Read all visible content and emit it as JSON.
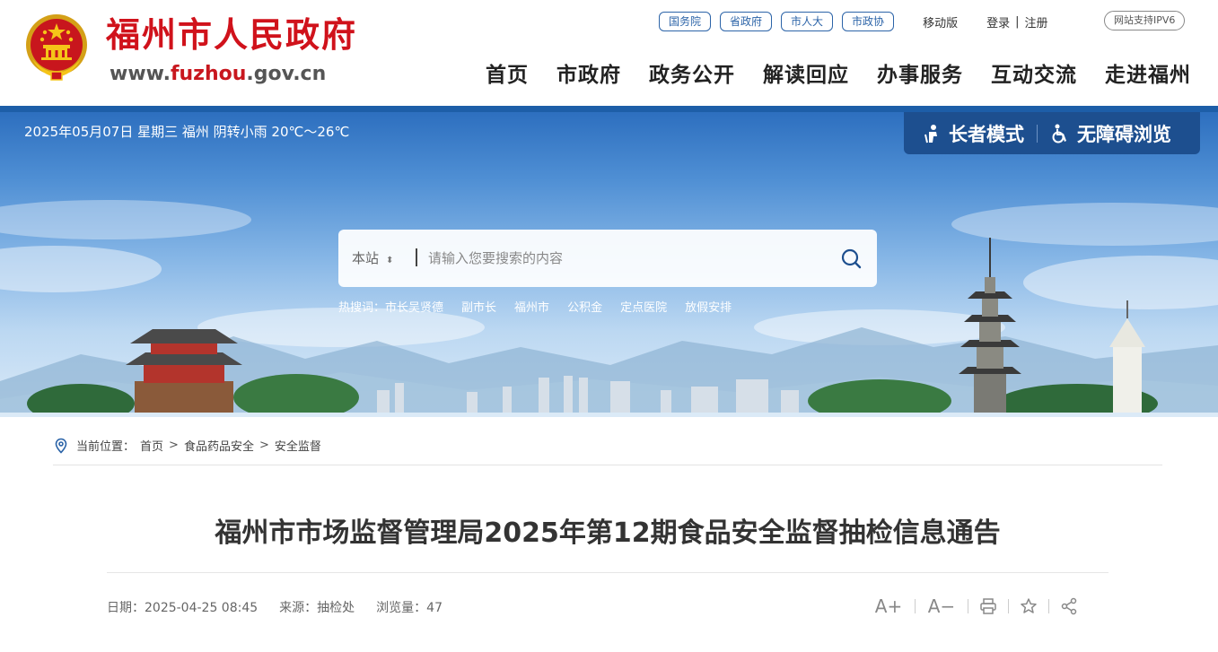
{
  "header": {
    "site_name": "福州市人民政府",
    "url_prefix": "www.",
    "url_mid": "fuzhou",
    "url_suffix": ".gov.cn",
    "top_links": [
      "国务院",
      "省政府",
      "市人大",
      "市政协"
    ],
    "mobile": "移动版",
    "login": "登录",
    "separator": "|",
    "register": "注册",
    "ipv6_badge": "网站支持IPV6",
    "nav": [
      "首页",
      "市政府",
      "政务公开",
      "解读回应",
      "办事服务",
      "互动交流",
      "走进福州"
    ]
  },
  "banner": {
    "weather": "2025年05月07日 星期三  福州 阴转小雨 20℃～26℃",
    "elder_mode": "长者模式",
    "accessible": "无障碍浏览",
    "search": {
      "scope": "本站",
      "placeholder": "请输入您要搜索的内容"
    },
    "hot_label": "热搜词：",
    "hot_words": [
      "市长吴贤德",
      "副市长",
      "福州市",
      "公积金",
      "定点医院",
      "放假安排"
    ]
  },
  "content": {
    "breadcrumb_label": "当前位置：",
    "breadcrumb": [
      "首页",
      "食品药品安全",
      "安全监督"
    ],
    "breadcrumb_sep": ">",
    "title": "福州市市场监督管理局2025年第12期食品安全监督抽检信息通告",
    "date": "日期：2025-04-25 08:45",
    "source": "来源：抽检处",
    "views": "浏览量：47",
    "font_larger": "A+",
    "font_smaller": "A−"
  },
  "colors": {
    "brand_red": "#d0121b",
    "brand_blue": "#1d5ea8",
    "access_bg": "#1d4f8f"
  }
}
